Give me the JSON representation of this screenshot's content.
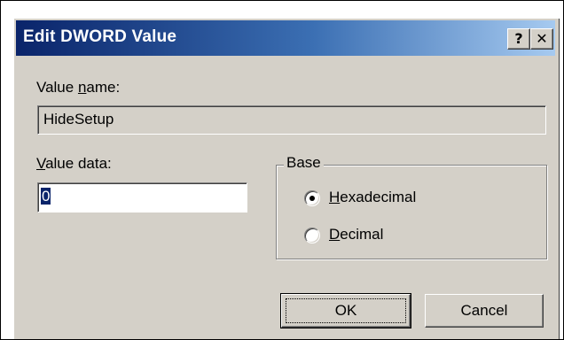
{
  "dialog": {
    "title": "Edit DWORD Value",
    "help_button": "?",
    "close_button": "✕"
  },
  "value_name": {
    "label_prefix": "Value ",
    "label_accel": "n",
    "label_rest": "ame:",
    "value": "HideSetup"
  },
  "value_data": {
    "label_accel": "V",
    "label_rest": "alue data:",
    "value": "0"
  },
  "base": {
    "title": "Base",
    "options": [
      {
        "accel": "H",
        "rest": "exadecimal",
        "selected": true
      },
      {
        "accel": "D",
        "rest": "ecimal",
        "selected": false
      }
    ]
  },
  "buttons": {
    "ok": "OK",
    "cancel": "Cancel"
  },
  "colors": {
    "dialog_face": "#d4d0c8",
    "titlebar_start": "#0a246a",
    "titlebar_end": "#a6caf0",
    "selection": "#0a246a"
  }
}
